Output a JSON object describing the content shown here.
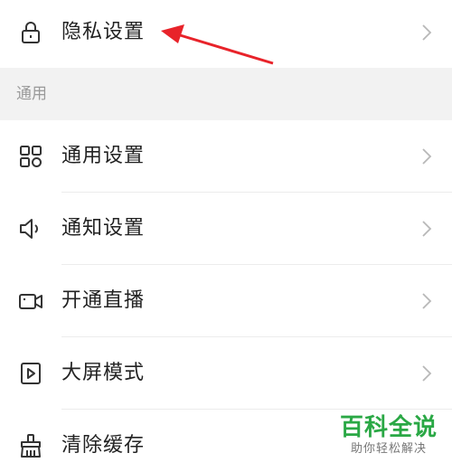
{
  "privacy": {
    "label": "隐私设置",
    "icon": "lock-icon"
  },
  "section": {
    "title": "通用"
  },
  "items": [
    {
      "label": "通用设置",
      "icon": "grid-icon"
    },
    {
      "label": "通知设置",
      "icon": "speaker-icon"
    },
    {
      "label": "开通直播",
      "icon": "video-camera-icon"
    },
    {
      "label": "大屏模式",
      "icon": "play-box-icon"
    },
    {
      "label": "清除缓存",
      "icon": "broom-icon"
    }
  ],
  "watermark": {
    "title": "百科全说",
    "subtitle": "助你轻松解决"
  },
  "colors": {
    "annotation_arrow": "#e8232a",
    "watermark_green": "#2aa845",
    "section_bg": "#f2f2f2"
  }
}
